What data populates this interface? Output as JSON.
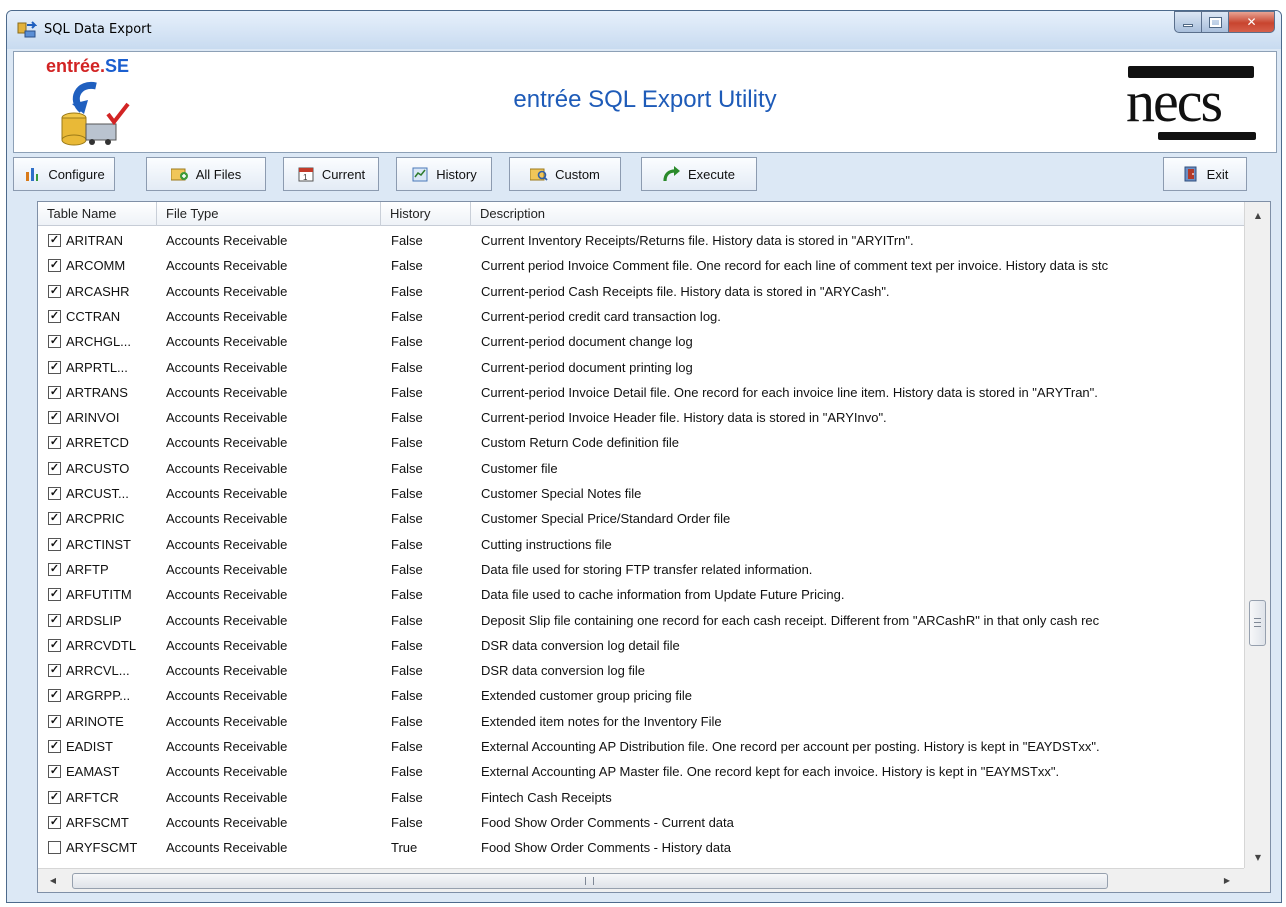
{
  "window": {
    "title": "SQL Data Export",
    "controls": {
      "minimize": "minimize",
      "maximize": "maximize",
      "close": "close"
    }
  },
  "banner": {
    "logo_text_a": "entrée.",
    "logo_text_b": "SE",
    "title": "entrée SQL Export Utility",
    "brand": "necs"
  },
  "toolbar": {
    "buttons": [
      {
        "label": "Configure",
        "icon": "configure-icon"
      },
      {
        "label": "All Files",
        "icon": "all-files-icon"
      },
      {
        "label": "Current",
        "icon": "current-icon"
      },
      {
        "label": "History",
        "icon": "history-icon"
      },
      {
        "label": "Custom",
        "icon": "custom-icon"
      },
      {
        "label": "Execute",
        "icon": "execute-arrow-icon"
      },
      {
        "label": "Exit",
        "icon": "exit-door-icon"
      }
    ]
  },
  "grid": {
    "columns": [
      "Table Name",
      "File Type",
      "History",
      "Description"
    ],
    "rows": [
      {
        "checked": true,
        "name": "ARITRAN",
        "type": "Accounts Receivable",
        "history": "False",
        "desc": "Current Inventory Receipts/Returns file. History data is stored in \"ARYITrn\"."
      },
      {
        "checked": true,
        "name": "ARCOMM",
        "type": "Accounts Receivable",
        "history": "False",
        "desc": "Current period Invoice Comment file. One record for each line of comment text per invoice. History data is stc"
      },
      {
        "checked": true,
        "name": "ARCASHR",
        "type": "Accounts Receivable",
        "history": "False",
        "desc": "Current-period Cash Receipts file. History data is stored in \"ARYCash\"."
      },
      {
        "checked": true,
        "name": "CCTRAN",
        "type": "Accounts Receivable",
        "history": "False",
        "desc": "Current-period credit card transaction log."
      },
      {
        "checked": true,
        "name": "ARCHGL...",
        "type": "Accounts Receivable",
        "history": "False",
        "desc": "Current-period document change log"
      },
      {
        "checked": true,
        "name": "ARPRTL...",
        "type": "Accounts Receivable",
        "history": "False",
        "desc": "Current-period document printing log"
      },
      {
        "checked": true,
        "name": "ARTRANS",
        "type": "Accounts Receivable",
        "history": "False",
        "desc": "Current-period Invoice Detail file. One record for each invoice line item. History data is stored in \"ARYTran\"."
      },
      {
        "checked": true,
        "name": "ARINVOI",
        "type": "Accounts Receivable",
        "history": "False",
        "desc": "Current-period Invoice Header file. History data is stored in \"ARYInvo\"."
      },
      {
        "checked": true,
        "name": "ARRETCD",
        "type": "Accounts Receivable",
        "history": "False",
        "desc": "Custom Return Code definition file"
      },
      {
        "checked": true,
        "name": "ARCUSTO",
        "type": "Accounts Receivable",
        "history": "False",
        "desc": "Customer file"
      },
      {
        "checked": true,
        "name": "ARCUST...",
        "type": "Accounts Receivable",
        "history": "False",
        "desc": "Customer Special Notes file"
      },
      {
        "checked": true,
        "name": "ARCPRIC",
        "type": "Accounts Receivable",
        "history": "False",
        "desc": "Customer Special Price/Standard Order file"
      },
      {
        "checked": true,
        "name": "ARCTINST",
        "type": "Accounts Receivable",
        "history": "False",
        "desc": "Cutting instructions file"
      },
      {
        "checked": true,
        "name": "ARFTP",
        "type": "Accounts Receivable",
        "history": "False",
        "desc": "Data file used for storing FTP transfer related information."
      },
      {
        "checked": true,
        "name": "ARFUTITM",
        "type": "Accounts Receivable",
        "history": "False",
        "desc": "Data file used to cache information from Update Future Pricing."
      },
      {
        "checked": true,
        "name": "ARDSLIP",
        "type": "Accounts Receivable",
        "history": "False",
        "desc": "Deposit Slip file containing one record for each cash receipt. Different from \"ARCashR\" in that only cash rec"
      },
      {
        "checked": true,
        "name": "ARRCVDTL",
        "type": "Accounts Receivable",
        "history": "False",
        "desc": "DSR data conversion log detail file"
      },
      {
        "checked": true,
        "name": "ARRCVL...",
        "type": "Accounts Receivable",
        "history": "False",
        "desc": "DSR data conversion log file"
      },
      {
        "checked": true,
        "name": "ARGRPP...",
        "type": "Accounts Receivable",
        "history": "False",
        "desc": "Extended customer group pricing file"
      },
      {
        "checked": true,
        "name": "ARINOTE",
        "type": "Accounts Receivable",
        "history": "False",
        "desc": "Extended item notes for the Inventory File"
      },
      {
        "checked": true,
        "name": "EADIST",
        "type": "Accounts Receivable",
        "history": "False",
        "desc": "External Accounting AP Distribution file. One record per account per posting. History is kept in \"EAYDSTxx\"."
      },
      {
        "checked": true,
        "name": "EAMAST",
        "type": "Accounts Receivable",
        "history": "False",
        "desc": "External Accounting AP Master file. One record kept for each invoice. History is kept in \"EAYMSTxx\"."
      },
      {
        "checked": true,
        "name": "ARFTCR",
        "type": "Accounts Receivable",
        "history": "False",
        "desc": "Fintech Cash Receipts"
      },
      {
        "checked": true,
        "name": "ARFSCMT",
        "type": "Accounts Receivable",
        "history": "False",
        "desc": "Food Show Order Comments - Current data"
      },
      {
        "checked": false,
        "name": "ARYFSCMT",
        "type": "Accounts Receivable",
        "history": "True",
        "desc": "Food Show Order Comments - History data"
      }
    ]
  }
}
